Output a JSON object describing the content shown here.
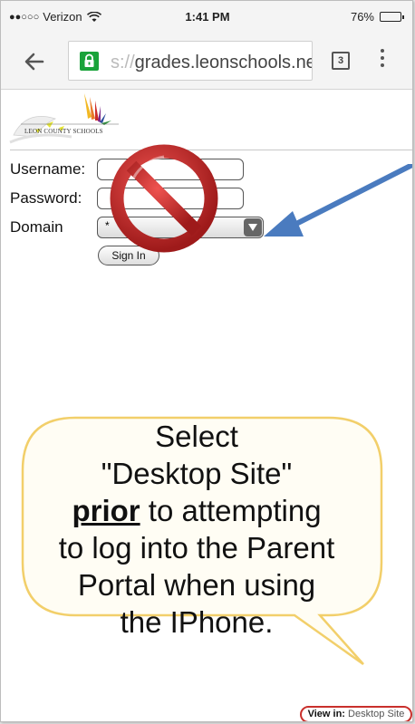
{
  "status_bar": {
    "signal": "●●○○○",
    "carrier": "Verizon",
    "time": "1:41 PM",
    "battery_percent": "76%",
    "battery_level": 0.76
  },
  "browser": {
    "url_faded": "s://",
    "url_text": "grades.leonschools.net",
    "tab_count": "3",
    "icons": [
      "back-arrow-icon",
      "lock-icon",
      "tabs-icon",
      "overflow-menu-icon"
    ]
  },
  "page": {
    "logo_text": "LEON COUNTY SCHOOLS",
    "username_label": "Username:",
    "password_label": "Password:",
    "domain_label": "Domain",
    "domain_value": "*",
    "signin_label": "Sign In"
  },
  "annotation": {
    "line1": "Select",
    "line2": "\"Desktop Site\"",
    "line3_emphasis": "prior",
    "line3_rest": " to attempting",
    "line4": "to log into the Parent",
    "line5": "Portal when using",
    "line6": "the IPhone."
  },
  "footer": {
    "view_in_label": "View in:",
    "view_in_value": "Desktop Site"
  },
  "colors": {
    "accent_arrow": "#4a7bbf",
    "no_sign_red": "#c62828",
    "bubble_border": "#f2cf6a",
    "lock_green": "#1aa33a",
    "highlight_red": "#c9302c"
  }
}
